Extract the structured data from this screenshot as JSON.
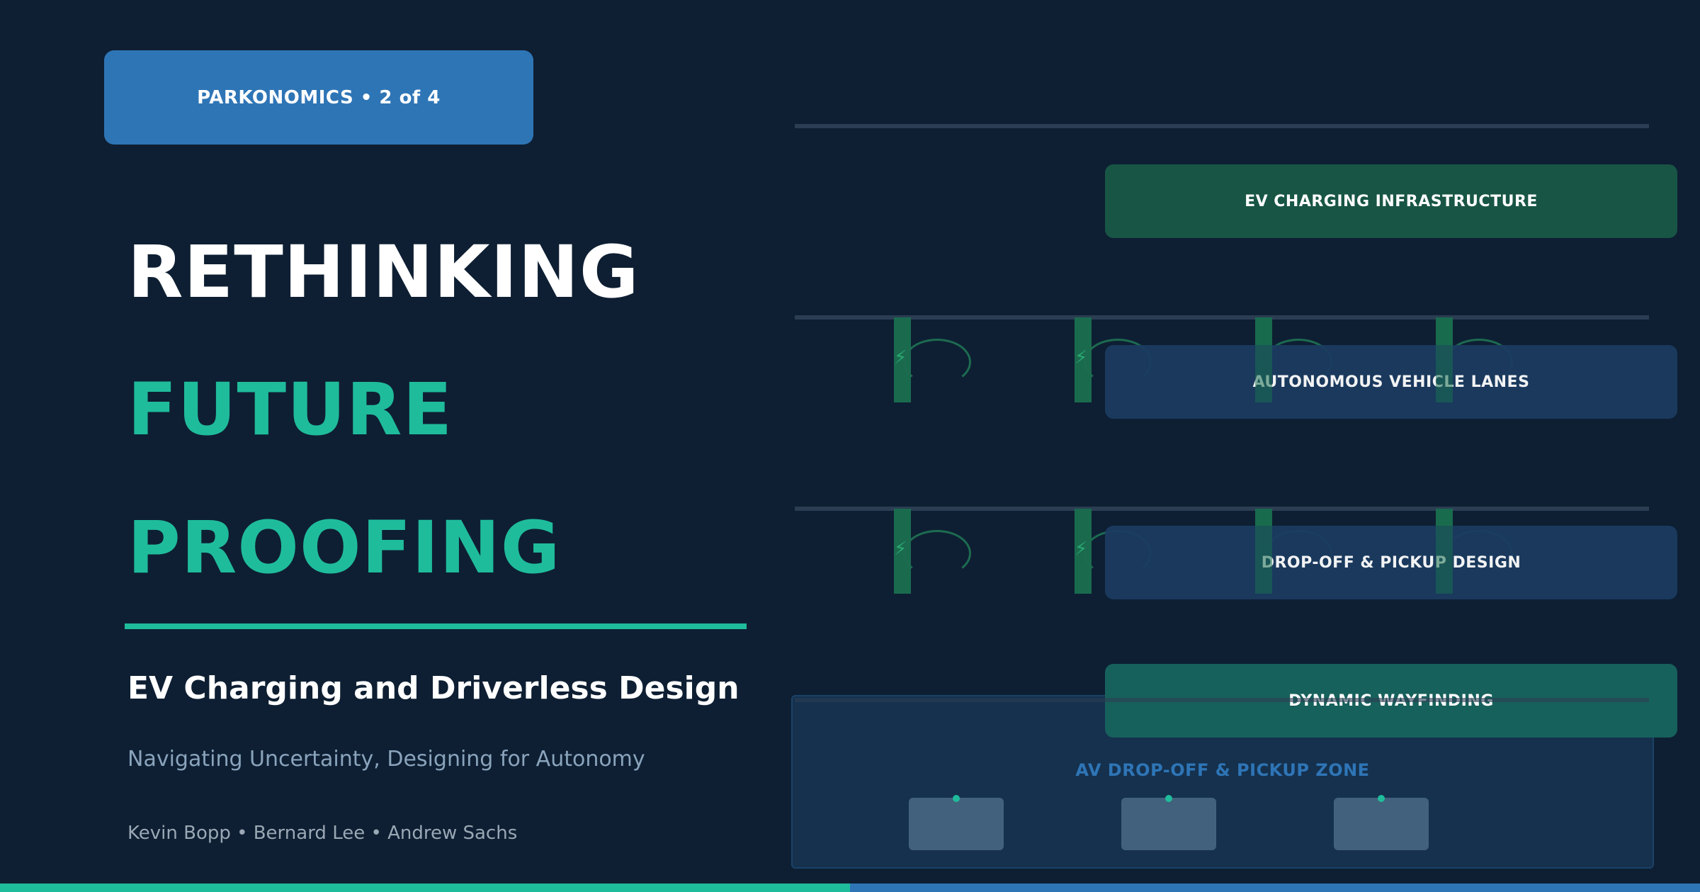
{
  "header": {
    "series_label": "PARKONOMICS  •  2 of 4"
  },
  "title": {
    "line1": "RETHINKING",
    "line2": "FUTURE",
    "line3": "PROOFING"
  },
  "subtitle": "EV Charging and Driverless Design",
  "tagline": "Navigating Uncertainty, Designing for Autonomy",
  "authors": "Kevin Bopp  •  Bernard Lee  •  Andrew Sachs",
  "features": [
    "EV CHARGING INFRASTRUCTURE",
    "AUTONOMOUS VEHICLE LANES",
    "DROP-OFF & PICKUP DESIGN",
    "DYNAMIC WAYFINDING"
  ],
  "zone": {
    "label": "AV DROP-OFF & PICKUP ZONE"
  },
  "icons": {
    "charger": "lightning-bolt-icon",
    "car": "car-icon"
  },
  "colors": {
    "background": "#0e1f33",
    "accent_teal": "#1fbc9c",
    "accent_blue": "#2e75b6"
  }
}
